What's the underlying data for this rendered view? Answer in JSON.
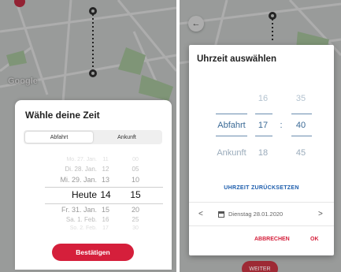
{
  "left": {
    "map_label": "Google",
    "sheet_title": "Wähle deine Zeit",
    "segments": [
      "Abfahrt",
      "Ankunft"
    ],
    "rows": [
      {
        "day": "Mo. 27. Jan.",
        "hour": "11",
        "minute": "00"
      },
      {
        "day": "Di. 28. Jan.",
        "hour": "12",
        "minute": "05"
      },
      {
        "day": "Mi. 29. Jan.",
        "hour": "13",
        "minute": "10"
      },
      {
        "day": "Heute",
        "hour": "14",
        "minute": "15"
      },
      {
        "day": "Fr. 31. Jan.",
        "hour": "15",
        "minute": "20"
      },
      {
        "day": "Sa. 1. Feb.",
        "hour": "16",
        "minute": "25"
      },
      {
        "day": "So. 2. Feb.",
        "hour": "17",
        "minute": "30"
      }
    ],
    "confirm_label": "Bestätigen",
    "accent": "#d51f3b"
  },
  "right": {
    "back_icon": "←",
    "dialog_title": "Uhrzeit auswählen",
    "top_hour": "16",
    "top_minute": "35",
    "dep_label": "Abfahrt",
    "dep_hour": "17",
    "separator": ":",
    "dep_minute": "40",
    "arr_label": "Ankunft",
    "arr_hour": "18",
    "arr_minute": "45",
    "reset_label": "UHRZEIT ZURÜCKSETZEN",
    "prev_icon": "<",
    "next_icon": ">",
    "date_label": "Dienstag 28.01.2020",
    "cancel_label": "ABBRECHEN",
    "ok_label": "OK",
    "weiter_label": "WEITER",
    "accent_blue": "#1b5cac"
  }
}
